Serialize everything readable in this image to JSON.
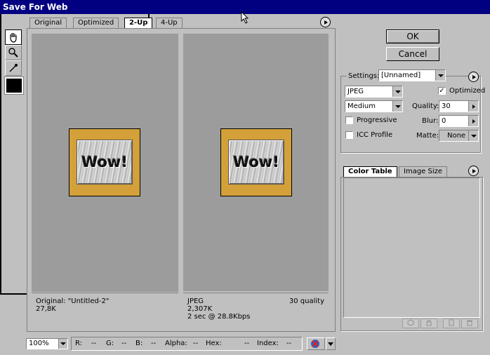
{
  "window": {
    "title": "Save For Web"
  },
  "tabs": [
    {
      "label": "Original",
      "active": false
    },
    {
      "label": "Optimized",
      "active": false
    },
    {
      "label": "2-Up",
      "active": true
    },
    {
      "label": "4-Up",
      "active": false
    }
  ],
  "tools": [
    "hand-icon",
    "zoom-icon",
    "eyedropper-icon"
  ],
  "previews": {
    "left": {
      "artwork_text": "Wow!",
      "line1": "Original: \"Untitled-2\"",
      "line2": "27,8K",
      "line3": ""
    },
    "right": {
      "artwork_text": "Wow!",
      "line1": "JPEG",
      "quality": "30 quality",
      "line2": "2,307K",
      "line3": "2 sec @ 28.8Kbps"
    }
  },
  "buttons": {
    "ok": "OK",
    "cancel": "Cancel"
  },
  "settings": {
    "label": "Settings:",
    "preset": "[Unnamed]",
    "format": "JPEG",
    "quality_preset": "Medium",
    "optimized_label": "Optimized",
    "optimized_checked": "✓",
    "quality_label": "Quality:",
    "quality_value": "30",
    "progressive_label": "Progressive",
    "blur_label": "Blur:",
    "blur_value": "0",
    "icc_label": "ICC Profile",
    "matte_label": "Matte:",
    "matte_value": "None"
  },
  "right_tabs": [
    {
      "label": "Color Table",
      "active": true
    },
    {
      "label": "Image Size",
      "active": false
    }
  ],
  "status": {
    "zoom": "100%",
    "r_label": "R:",
    "r_value": "--",
    "g_label": "G:",
    "g_value": "--",
    "b_label": "B:",
    "b_value": "--",
    "alpha_label": "Alpha:",
    "alpha_value": "--",
    "hex_label": "Hex:",
    "hex_value": "--",
    "index_label": "Index:",
    "index_value": "--"
  },
  "colors": {
    "titlebar": "#000080",
    "artwork_bg": "#d4a03a",
    "pane_bg": "#9c9c9c"
  }
}
